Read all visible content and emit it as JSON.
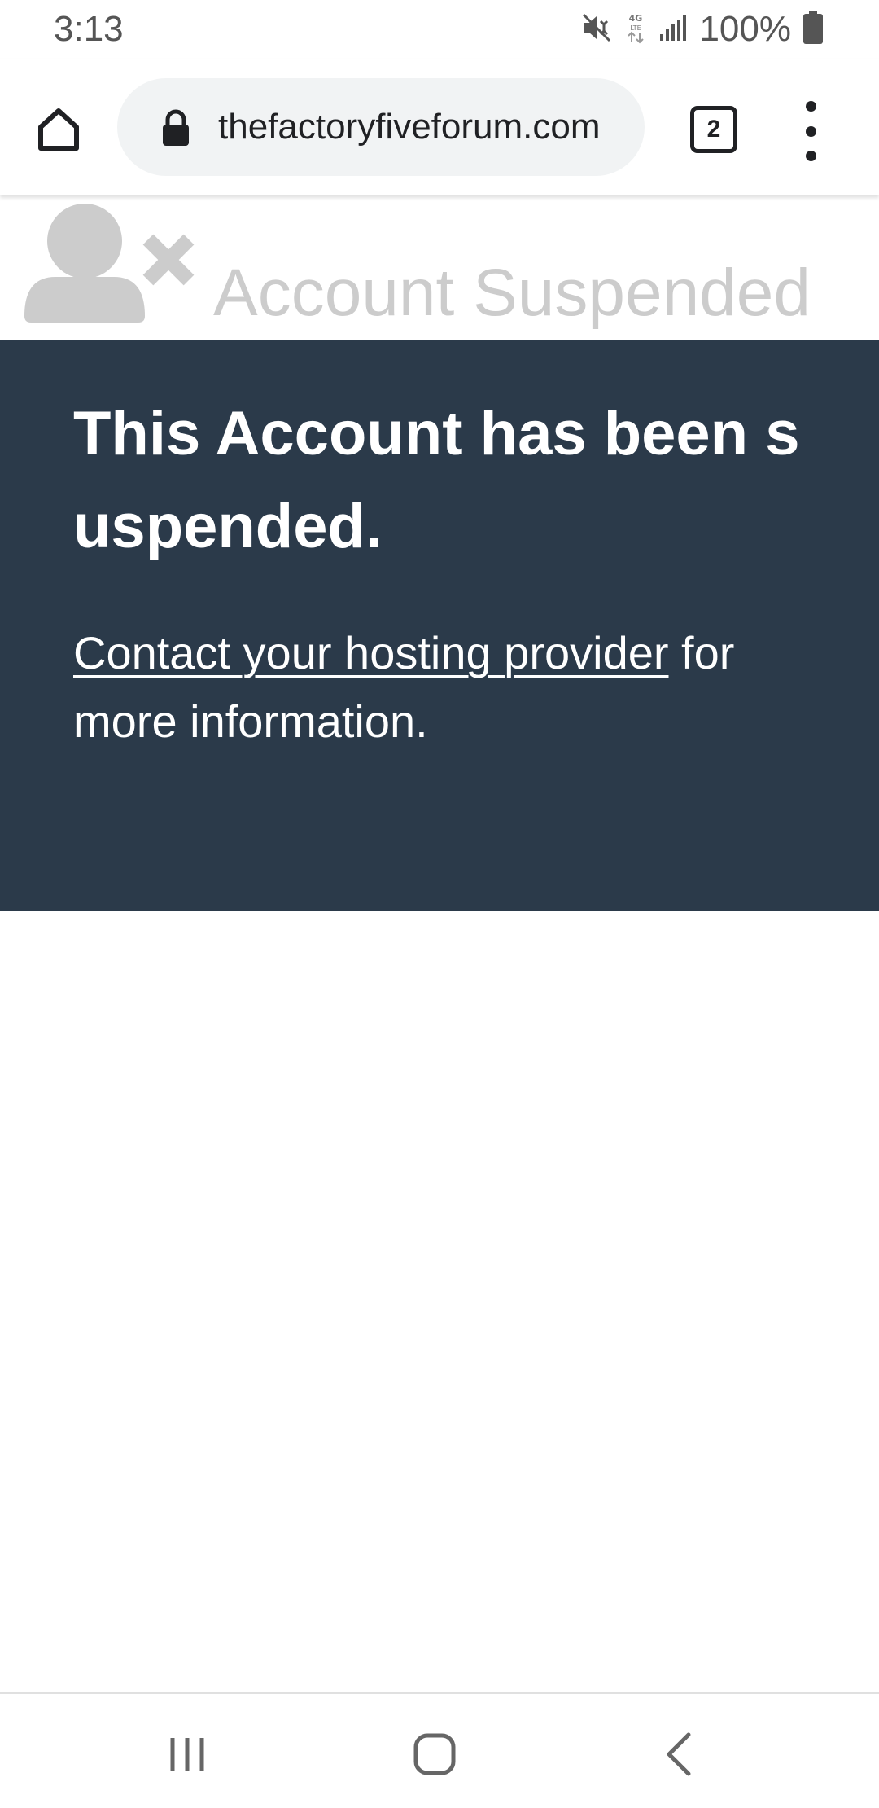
{
  "status_bar": {
    "time": "3:13",
    "battery_text": "100%",
    "icons": [
      "mute-icon",
      "lte-4g-icon",
      "signal-icon",
      "battery-icon"
    ]
  },
  "browser": {
    "url_text": "thefactoryfiveforum.com",
    "tab_count": "2",
    "icons": [
      "home-icon",
      "lock-icon",
      "tab-switcher-icon",
      "more-menu-icon"
    ]
  },
  "page": {
    "header_title": "Account Suspended",
    "header_icon": "user-x-icon",
    "heading": "This Account has been suspended.",
    "link_text": "Contact your hosting provider",
    "body_suffix": " for more information."
  },
  "nav_bar": {
    "icons": [
      "recent-apps-icon",
      "home-nav-icon",
      "back-icon"
    ]
  },
  "colors": {
    "banner_bg": "#2b3a4a",
    "header_gray": "#cccccc",
    "url_bar_bg": "#f1f3f4"
  }
}
